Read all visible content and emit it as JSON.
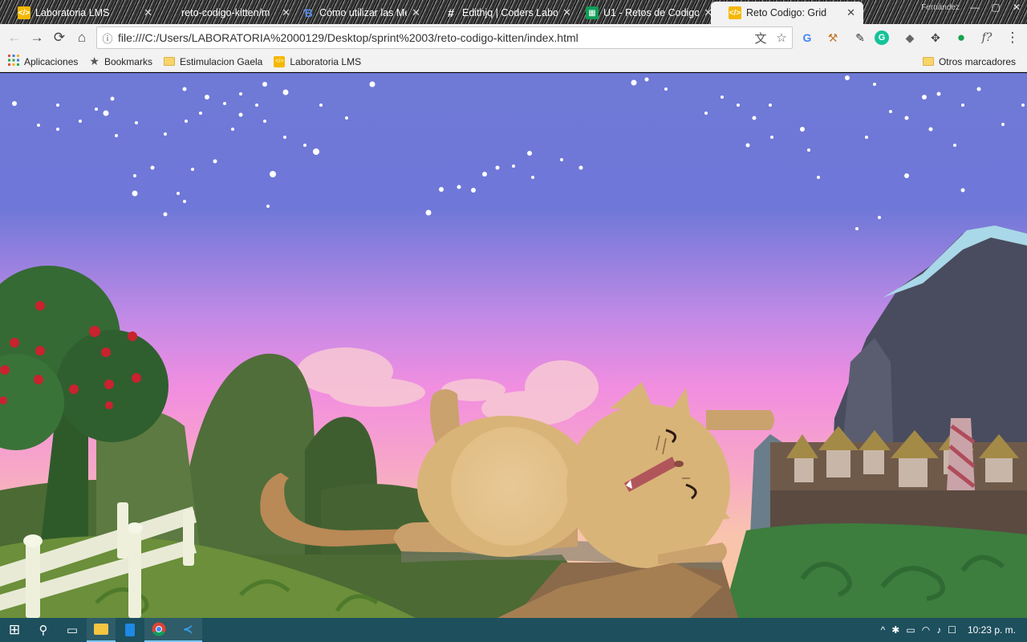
{
  "window": {
    "user_label": "Fernández",
    "minimize_glyph": "—",
    "maximize_glyph": "▢",
    "close_glyph": "✕"
  },
  "tabs": [
    {
      "title": "Laboratoria LMS",
      "icon": "laboratoria-icon",
      "color": "#f5b800",
      "active": false
    },
    {
      "title": "reto-codigo-kitten/m",
      "icon": "github-icon",
      "color": "#444444",
      "active": false
    },
    {
      "title": "Cómo utilizar las Me",
      "icon": "blog-icon",
      "color": "#2d6bd8",
      "active": false
    },
    {
      "title": "Edithjq | Coders Labo",
      "icon": "slack-icon",
      "color": "#4a154b",
      "active": false
    },
    {
      "title": "U1 - Retos de Codigo",
      "icon": "sheets-icon",
      "color": "#0f9d58",
      "active": false
    },
    {
      "title": "Reto Codigo: Grid",
      "icon": "laboratoria-icon",
      "color": "#f5b800",
      "active": true
    }
  ],
  "toolbar": {
    "url": "file:///C:/Users/LABORATORIA%2000129/Desktop/sprint%2003/reto-codigo-kitten/index.html",
    "back_glyph": "←",
    "forward_glyph": "→",
    "reload_glyph": "⟳",
    "home_glyph": "⌂",
    "info_glyph": "ⓘ",
    "translate_glyph": "文",
    "star_glyph": "☆",
    "menu_glyph": "⋮",
    "ext_glyphs": [
      "G",
      "⚒",
      "✎",
      "G",
      "◆",
      "✥",
      "●",
      "f?"
    ]
  },
  "bookmarks": {
    "apps_label": "Aplicaciones",
    "items": [
      {
        "label": "Bookmarks",
        "icon": "star-icon"
      },
      {
        "label": "Estimulacion Gaela",
        "icon": "folder-icon"
      },
      {
        "label": "Laboratoria LMS",
        "icon": "laboratoria-icon"
      }
    ],
    "other_label": "Otros marcadores"
  },
  "scene": {
    "sky_top": "#6f79d6",
    "sky_mid": "#f28ee0",
    "sky_horizon": "#f7b1b6",
    "cat_body": "#d9b478",
    "cat_belly": "#e5c28f",
    "cat_mouth": "#b0565a"
  },
  "taskbar": {
    "time": "10:23 p. m.",
    "start_glyph": "⊞",
    "search_glyph": "⚲",
    "taskview_glyph": "▭",
    "tray_glyphs": [
      "^",
      "✱",
      "▭",
      "◠",
      "♪",
      "☐"
    ]
  }
}
